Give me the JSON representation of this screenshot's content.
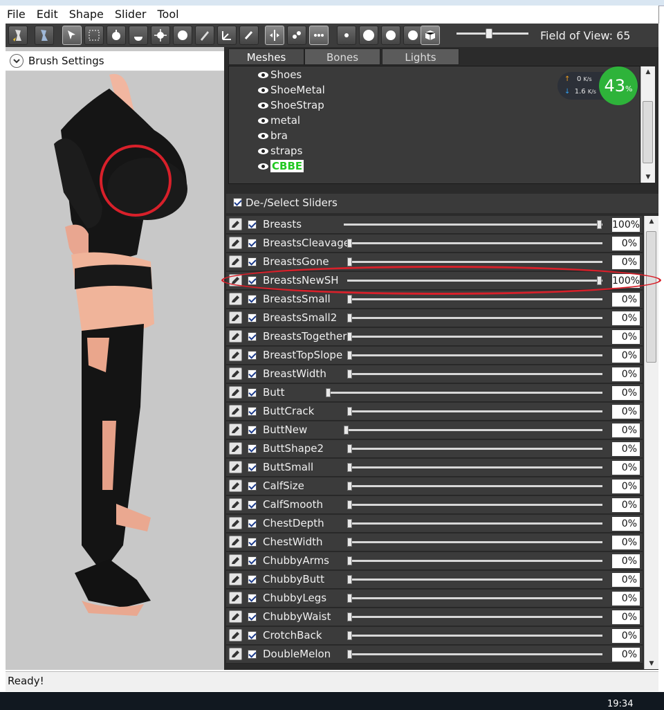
{
  "menubar": {
    "items": [
      "File",
      "Edit",
      "Shape",
      "Slider",
      "Tool"
    ]
  },
  "toolbar": {
    "fov_label": "Field of View: 65"
  },
  "left_panel": {
    "brush_settings_label": "Brush Settings"
  },
  "tabs": [
    "Meshes",
    "Bones",
    "Lights"
  ],
  "meshes": [
    "Shoes",
    "ShoeMetal",
    "ShoeStrap",
    "metal",
    "bra",
    "straps",
    "CBBE"
  ],
  "network": {
    "up": "0",
    "up_unit": "K/s",
    "down": "1.6",
    "down_unit": "K/s",
    "percent": "43",
    "percent_sign": "%"
  },
  "sliders_header": {
    "label": "De-/Select Sliders"
  },
  "sliders": [
    {
      "name": "Breasts",
      "value": "100%",
      "level": 1.0
    },
    {
      "name": "BreastsCleavage",
      "value": "0%",
      "level": 0
    },
    {
      "name": "BreastsGone",
      "value": "0%",
      "level": 0
    },
    {
      "name": "BreastsNewSH",
      "value": "100%",
      "level": 1.0
    },
    {
      "name": "BreastsSmall",
      "value": "0%",
      "level": 0
    },
    {
      "name": "BreastsSmall2",
      "value": "0%",
      "level": 0
    },
    {
      "name": "BreastsTogether",
      "value": "0%",
      "level": 0
    },
    {
      "name": "BreastTopSlope",
      "value": "0%",
      "level": 0
    },
    {
      "name": "BreastWidth",
      "value": "0%",
      "level": 0
    },
    {
      "name": "Butt",
      "value": "0%",
      "level": 0
    },
    {
      "name": "ButtCrack",
      "value": "0%",
      "level": 0
    },
    {
      "name": "ButtNew",
      "value": "0%",
      "level": 0
    },
    {
      "name": "ButtShape2",
      "value": "0%",
      "level": 0
    },
    {
      "name": "ButtSmall",
      "value": "0%",
      "level": 0
    },
    {
      "name": "CalfSize",
      "value": "0%",
      "level": 0
    },
    {
      "name": "CalfSmooth",
      "value": "0%",
      "level": 0
    },
    {
      "name": "ChestDepth",
      "value": "0%",
      "level": 0
    },
    {
      "name": "ChestWidth",
      "value": "0%",
      "level": 0
    },
    {
      "name": "ChubbyArms",
      "value": "0%",
      "level": 0
    },
    {
      "name": "ChubbyButt",
      "value": "0%",
      "level": 0
    },
    {
      "name": "ChubbyLegs",
      "value": "0%",
      "level": 0
    },
    {
      "name": "ChubbyWaist",
      "value": "0%",
      "level": 0
    },
    {
      "name": "CrotchBack",
      "value": "0%",
      "level": 0
    },
    {
      "name": "DoubleMelon",
      "value": "0%",
      "level": 0
    }
  ],
  "status": {
    "text": "Ready!"
  },
  "taskbar": {
    "clock": "19:34"
  }
}
